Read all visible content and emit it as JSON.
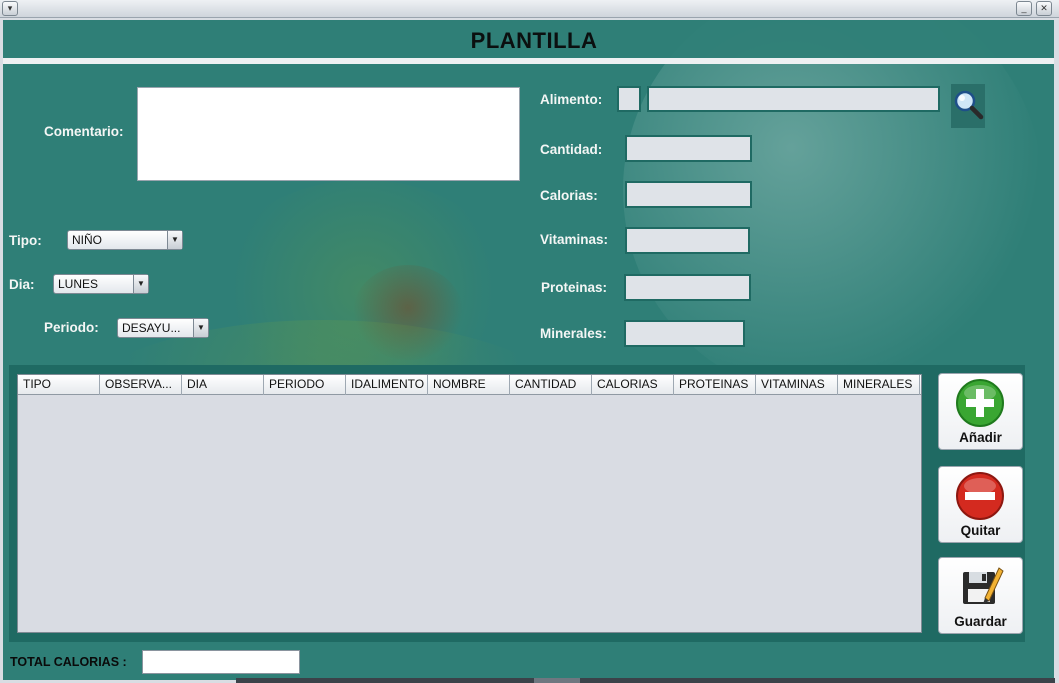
{
  "window": {
    "sysmenu_icon": "chevron-down-icon",
    "minimize_icon": "minimize-icon",
    "close_icon": "close-icon"
  },
  "header": {
    "title": "PLANTILLA"
  },
  "form": {
    "comentario_label": "Comentario:",
    "comentario_value": "",
    "tipo_label": "Tipo:",
    "tipo_value": "NIÑO",
    "dia_label": "Dia:",
    "dia_value": "LUNES",
    "periodo_label": "Periodo:",
    "periodo_value": "DESAYU...",
    "alimento_label": "Alimento:",
    "alimento_id": "",
    "alimento_name": "",
    "cantidad_label": "Cantidad:",
    "calorias_label": "Calorias:",
    "vitaminas_label": "Vitaminas:",
    "proteinas_label": "Proteinas:",
    "minerales_label": "Minerales:"
  },
  "table": {
    "columns": [
      "TIPO",
      "OBSERVA...",
      "DIA",
      "PERIODO",
      "IDALIMENTO",
      "NOMBRE",
      "CANTIDAD",
      "CALORIAS",
      "PROTEINAS",
      "VITAMINAS",
      "MINERALES"
    ],
    "rows": []
  },
  "actions": {
    "add_label": "Añadir",
    "remove_label": "Quitar",
    "save_label": "Guardar",
    "add_icon": "plus-circle-icon",
    "remove_icon": "minus-circle-icon",
    "save_icon": "floppy-disk-icon",
    "add_color": "#3aa632",
    "remove_color": "#d42a1f"
  },
  "footer": {
    "total_label": "TOTAL CALORIAS :",
    "total_value": ""
  },
  "colors": {
    "panel_teal": "#2f7f77",
    "dark_teal": "#1f6a63",
    "field_gray": "#dfe3e8"
  }
}
